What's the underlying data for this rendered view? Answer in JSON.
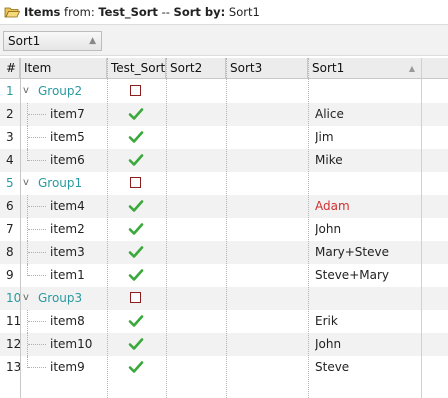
{
  "title": {
    "items_label": "Items",
    "from_label": " from: ",
    "source": "Test_Sort",
    "sep_label": " -- ",
    "sortby_label": "Sort by:",
    "sort_field": " Sort1"
  },
  "toolbar": {
    "sort_chip_label": "Sort1",
    "sort_chip_arrow": "▲"
  },
  "columns": [
    "#",
    "Item",
    "Test_Sort",
    "Sort2",
    "Sort3",
    "Sort1"
  ],
  "sort_column_arrow": "▲",
  "rows": [
    {
      "num": "1",
      "type": "group",
      "label": "Group2",
      "toggle": "v",
      "test_sort": "unchecked",
      "sort1": ""
    },
    {
      "num": "2",
      "type": "item",
      "label": "item7",
      "test_sort": "checked",
      "sort1": "Alice"
    },
    {
      "num": "3",
      "type": "item",
      "label": "item5",
      "test_sort": "checked",
      "sort1": "Jim"
    },
    {
      "num": "4",
      "type": "item",
      "label": "item6",
      "test_sort": "checked",
      "sort1": "Mike"
    },
    {
      "num": "5",
      "type": "group",
      "label": "Group1",
      "toggle": "v",
      "test_sort": "unchecked",
      "sort1": ""
    },
    {
      "num": "6",
      "type": "item",
      "label": "item4",
      "test_sort": "checked",
      "sort1": "Adam",
      "sort1_color": "#d03030"
    },
    {
      "num": "7",
      "type": "item",
      "label": "item2",
      "test_sort": "checked",
      "sort1": "John"
    },
    {
      "num": "8",
      "type": "item",
      "label": "item3",
      "test_sort": "checked",
      "sort1": "Mary+Steve"
    },
    {
      "num": "9",
      "type": "item",
      "label": "item1",
      "test_sort": "checked",
      "sort1": "Steve+Mary"
    },
    {
      "num": "10",
      "type": "group",
      "label": "Group3",
      "toggle": "v",
      "test_sort": "unchecked",
      "sort1": ""
    },
    {
      "num": "11",
      "type": "item",
      "label": "item8",
      "test_sort": "checked",
      "sort1": "Erik"
    },
    {
      "num": "12",
      "type": "item",
      "label": "item10",
      "test_sort": "checked",
      "sort1": "John"
    },
    {
      "num": "13",
      "type": "item",
      "label": "item9",
      "test_sort": "checked",
      "sort1": "Steve"
    }
  ],
  "colors": {
    "group_text": "#2a9aa0",
    "check_green": "#3aa83a",
    "checkbox_border": "#8b1e1e",
    "alt_row": "#f2f2f2"
  },
  "icons": {
    "title_icon": "open-folder-icon",
    "check_icon": "green-checkmark-icon",
    "unchecked_icon": "empty-checkbox-icon",
    "expand_icon": "chevron-down-icon"
  }
}
